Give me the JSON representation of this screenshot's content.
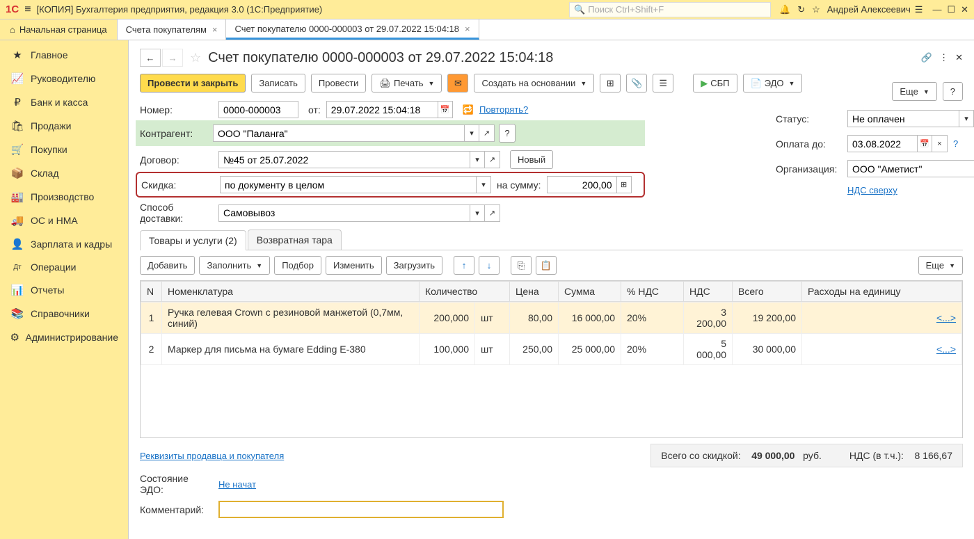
{
  "app": {
    "title": "[КОПИЯ] Бухгалтерия предприятия, редакция 3.0  (1С:Предприятие)",
    "search_placeholder": "Поиск Ctrl+Shift+F",
    "user": "Андрей Алексеевич"
  },
  "tabs": {
    "home": "Начальная страница",
    "t1": "Счета покупателям",
    "t2": "Счет покупателю 0000-000003 от 29.07.2022 15:04:18"
  },
  "sidebar": [
    {
      "icon": "★",
      "label": "Главное"
    },
    {
      "icon": "📈",
      "label": "Руководителю"
    },
    {
      "icon": "₽",
      "label": "Банк и касса"
    },
    {
      "icon": "🛍",
      "label": "Продажи"
    },
    {
      "icon": "🛒",
      "label": "Покупки"
    },
    {
      "icon": "📦",
      "label": "Склад"
    },
    {
      "icon": "🏭",
      "label": "Производство"
    },
    {
      "icon": "🚚",
      "label": "ОС и НМА"
    },
    {
      "icon": "👤",
      "label": "Зарплата и кадры"
    },
    {
      "icon": "Дт",
      "label": "Операции"
    },
    {
      "icon": "📊",
      "label": "Отчеты"
    },
    {
      "icon": "📚",
      "label": "Справочники"
    },
    {
      "icon": "⚙",
      "label": "Администрирование"
    }
  ],
  "doc": {
    "title": "Счет покупателю 0000-000003 от 29.07.2022 15:04:18",
    "actions": {
      "post_close": "Провести и закрыть",
      "save": "Записать",
      "post": "Провести",
      "print": "Печать",
      "create_based": "Создать на основании",
      "sbp": "СБП",
      "edo": "ЭДО",
      "more": "Еще",
      "help": "?"
    },
    "fields": {
      "number_label": "Номер:",
      "number": "0000-000003",
      "date_label": "от:",
      "date": "29.07.2022 15:04:18",
      "repeat": "Повторять?",
      "counterparty_label": "Контрагент:",
      "counterparty": "ООО \"Паланга\"",
      "contract_label": "Договор:",
      "contract": "№45 от 25.07.2022",
      "new_btn": "Новый",
      "discount_label": "Скидка:",
      "discount": "по документу в целом",
      "amount_label": "на сумму:",
      "amount": "200,00",
      "delivery_label": "Способ доставки:",
      "delivery": "Самовывоз",
      "status_label": "Статус:",
      "status": "Не оплачен",
      "pay_until_label": "Оплата до:",
      "pay_until": "03.08.2022",
      "org_label": "Организация:",
      "org": "ООО \"Аметист\"",
      "vat_link": "НДС сверху"
    },
    "tabs": {
      "goods": "Товары и услуги (2)",
      "tare": "Возвратная тара"
    },
    "tbl_toolbar": {
      "add": "Добавить",
      "fill": "Заполнить",
      "pick": "Подбор",
      "edit": "Изменить",
      "load": "Загрузить",
      "more": "Еще"
    },
    "table": {
      "headers": {
        "n": "N",
        "item": "Номенклатура",
        "qty": "Количество",
        "price": "Цена",
        "sum": "Сумма",
        "vat_pct": "% НДС",
        "vat": "НДС",
        "total": "Всего",
        "unit_cost": "Расходы на единицу"
      },
      "rows": [
        {
          "n": "1",
          "item": "Ручка гелевая Crown с резиновой манжетой (0,7мм, синий)",
          "qty": "200,000",
          "unit": "шт",
          "price": "80,00",
          "sum": "16 000,00",
          "vat_pct": "20%",
          "vat": "3 200,00",
          "total": "19 200,00",
          "link": "<...>"
        },
        {
          "n": "2",
          "item": "Маркер для письма на бумаге Edding E-380",
          "qty": "100,000",
          "unit": "шт",
          "price": "250,00",
          "sum": "25 000,00",
          "vat_pct": "20%",
          "vat": "5 000,00",
          "total": "30 000,00",
          "link": "<...>"
        }
      ]
    },
    "footer": {
      "requisites": "Реквизиты продавца и покупателя",
      "total_label": "Всего со скидкой:",
      "total": "49 000,00",
      "currency": "руб.",
      "vat_label": "НДС (в т.ч.):",
      "vat": "8 166,67",
      "edo_state_label": "Состояние ЭДО:",
      "edo_state": "Не начат",
      "comment_label": "Комментарий:"
    }
  }
}
